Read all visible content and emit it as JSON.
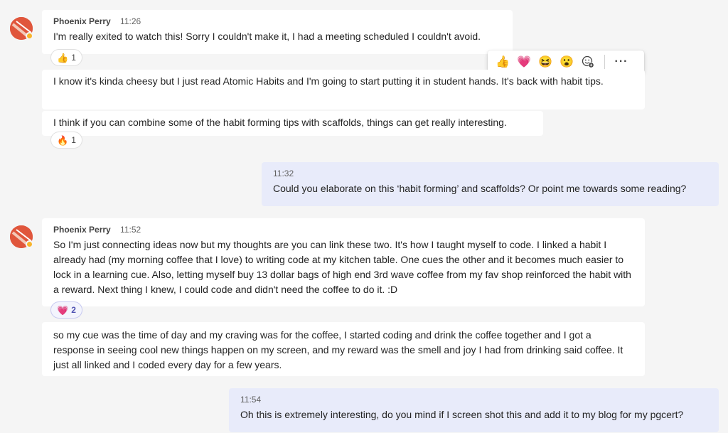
{
  "messages": [
    {
      "sender": "Phoenix Perry",
      "time": "11:26",
      "text": "I'm really exited to watch this! Sorry I couldn't make it, I had a meeting scheduled I couldn't avoid.",
      "reaction": {
        "emoji": "👍",
        "count": "1"
      }
    },
    {
      "text": "I know it's kinda cheesy but I just read Atomic Habits and I'm going to start putting it in student hands. It's back with habit tips."
    },
    {
      "text": "I think if you can combine some of the habit forming tips with scaffolds, things can get really interesting.",
      "reaction": {
        "emoji": "🔥",
        "count": "1"
      }
    },
    {
      "time": "11:32",
      "text": "Could you elaborate on this ‘habit forming’ and scaffolds? Or point me towards some reading?"
    },
    {
      "sender": "Phoenix Perry",
      "time": "11:52",
      "text": "So I'm just connecting ideas now but my thoughts are you can link these two. It's how I taught myself to code. I linked a habit I already had (my morning coffee that I love) to writing code at my kitchen table. One cues the other and it becomes much easier to lock in a learning cue. Also, letting myself buy 13 dollar bags of high end 3rd wave coffee from my fav shop reinforced the habit with a reward. Next thing I knew, I could code and didn't need the coffee to do it. :D",
      "reaction": {
        "emoji": "💗",
        "count": "2"
      }
    },
    {
      "text": "so my cue was the time of day and my craving was for the coffee, I started coding and drink the coffee together and I got a response in seeing cool new things happen on my screen, and my reward was the smell and joy I had from drinking said coffee. It just all linked and I coded every day for a few years."
    },
    {
      "time": "11:54",
      "text": "Oh this is extremely interesting, do you mind if I screen shot this and add it to my blog for my pgcert?"
    }
  ],
  "hover_bar": {
    "reactions": [
      "👍",
      "💗",
      "😆",
      "😮"
    ],
    "add_reaction_icon": "add-reaction-icon",
    "more_label": "···"
  },
  "colors": {
    "background": "#f5f5f5",
    "incoming_bubble": "#ffffff",
    "outgoing_bubble": "#e8ebfa",
    "avatar": "#e0563c",
    "presence_away": "#f8b42b"
  }
}
